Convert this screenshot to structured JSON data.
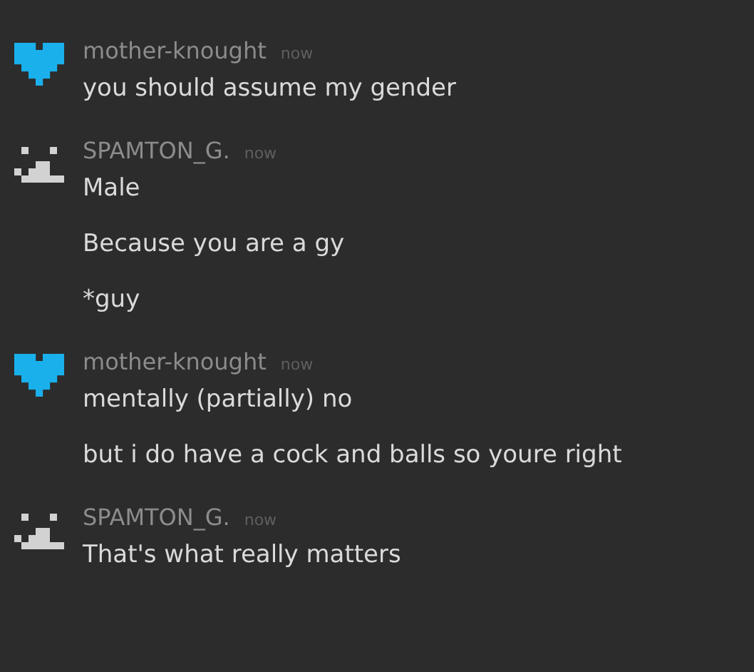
{
  "messages": [
    {
      "author": "mother-knought",
      "time": "now",
      "avatar": {
        "kind": "heart",
        "color": "#1ab0ec"
      },
      "lines": [
        "you should assume my gender"
      ]
    },
    {
      "author": "SPAMTON_G.",
      "time": "now",
      "avatar": {
        "kind": "face",
        "color": "#d2d2d2"
      },
      "lines": [
        "Male",
        "Because you are a gy",
        "*guy"
      ]
    },
    {
      "author": "mother-knought",
      "time": "now",
      "avatar": {
        "kind": "heart",
        "color": "#1ab0ec"
      },
      "lines": [
        "mentally (partially) no",
        "but i do have a cock and balls so youre right"
      ]
    },
    {
      "author": "SPAMTON_G.",
      "time": "now",
      "avatar": {
        "kind": "face",
        "color": "#d2d2d2"
      },
      "lines": [
        "That's what really matters"
      ]
    }
  ]
}
